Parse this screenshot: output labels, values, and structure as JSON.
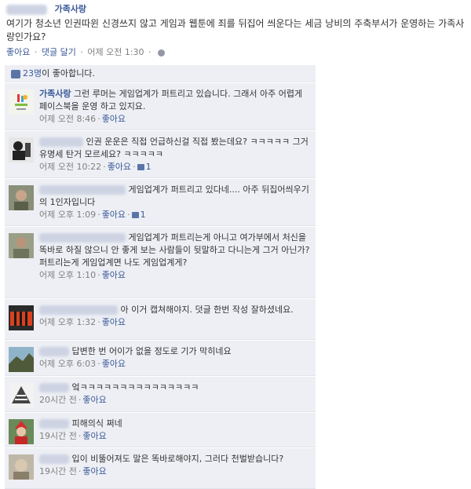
{
  "post": {
    "author_name": "가족사랑",
    "text": "여기가 청소년 인권따윈 신경쓰지 않고 게임과 웹툰에 죄를 뒤집어 씌운다는 세금 낭비의 주축부서가 운영하는 가족사랑인가요?",
    "actions": {
      "like": "좋아요",
      "comment": "댓글 달기",
      "time": "어제 오전 1:30"
    }
  },
  "likes": {
    "count": "23명",
    "suffix": "이 좋아합니다."
  },
  "comments": [
    {
      "author": "가족사랑",
      "text": "그런 루머는 게임업계가 퍼트리고 있습니다. 그래서 아주 어렵게 페이스북을 운영 하고 있지요.",
      "time": "어제 오전 8:46",
      "like": "좋아요"
    },
    {
      "text": "인권 운운은 직접 언급하신걸 직접 봤는데요? ㅋㅋㅋㅋㅋ 그거 유명세 탄거 모르세요? ㅋㅋㅋㅋㅋ",
      "time": "어제 오전 10:22",
      "like": "좋아요",
      "likes": "1"
    },
    {
      "text": "게임업계가 퍼트리고 있다네.... 아주 뒤집어씌우기의 1인자입니다",
      "time": "어제 오후 1:09",
      "like": "좋아요",
      "likes": "1"
    },
    {
      "text": "게임업계가 퍼트리는게 아니고 여가부에서 처신을 똑바로 하질 않으니 안 좋게 보는 사람들이 뒷말하고 다니는게 그거 아닌가? 퍼트리는게 게임업계면 나도 게임업계게?",
      "time": "어제 오후 1:10",
      "like": "좋아요"
    },
    {
      "text": "아 이거 캡쳐해야지. 덧글 한번 작성 잘하셨네요.",
      "time": "어제 오후 1:32",
      "like": "좋아요"
    },
    {
      "text": "답변한 번 어이가 없을 정도로 기가 막히네요",
      "time": "어제 오후 6:03",
      "like": "좋아요"
    },
    {
      "text": "엌ㅋㅋㅋㅋㅋㅋㅋㅋㅋㅋㅋㅋㅋㅋㅋ",
      "time": "20시간 전",
      "like": "좋아요"
    },
    {
      "text": "피해의식 쩌네",
      "time": "19시간 전",
      "like": "좋아요"
    },
    {
      "text": "입이 비뚤어져도 말은 똑바로해야지, 그러다 천벌받습니다?",
      "time": "19시간 전",
      "like": "좋아요"
    }
  ]
}
